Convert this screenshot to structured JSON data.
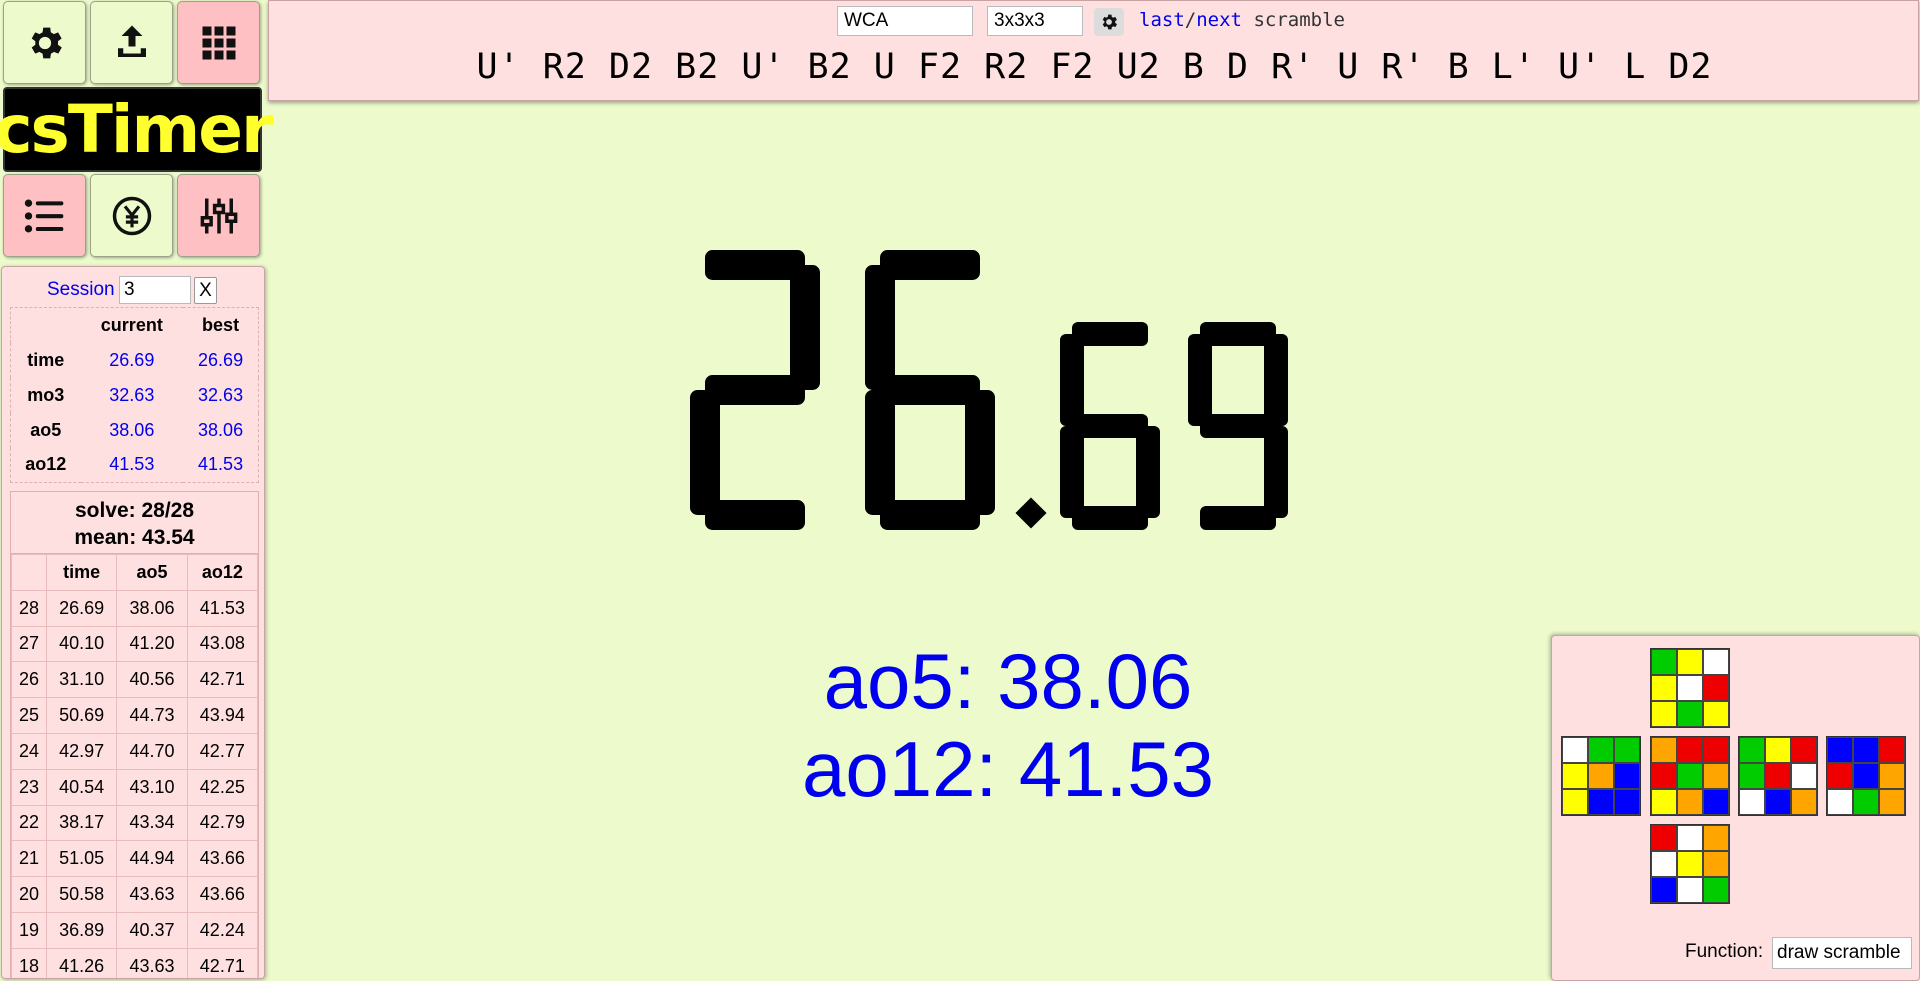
{
  "app": {
    "logo_text": "csTimer"
  },
  "toolbar": {
    "buttons": [
      "gear-icon",
      "export-icon",
      "grid-icon",
      "list-icon",
      "donate-icon",
      "sliders-icon"
    ]
  },
  "scramble": {
    "event_type": "WCA",
    "puzzle": "3x3x3",
    "last_label": "last",
    "sep": "/",
    "next_label": "next",
    "scramble_word": "scramble",
    "text": "U' R2 D2 B2 U' B2 U F2 R2 F2 U2 B D R' U R' B L' U' L D2"
  },
  "session": {
    "label": "Session",
    "value": "3",
    "delete_label": "X"
  },
  "stats": {
    "headers": [
      "current",
      "best"
    ],
    "rows": [
      {
        "name": "time",
        "current": "26.69",
        "best": "26.69"
      },
      {
        "name": "mo3",
        "current": "32.63",
        "best": "32.63"
      },
      {
        "name": "ao5",
        "current": "38.06",
        "best": "38.06"
      },
      {
        "name": "ao12",
        "current": "41.53",
        "best": "41.53"
      }
    ]
  },
  "summary": {
    "solve": "solve: 28/28",
    "mean": "mean: 43.54"
  },
  "times": {
    "headers": [
      "",
      "time",
      "ao5",
      "ao12"
    ],
    "rows": [
      [
        "28",
        "26.69",
        "38.06",
        "41.53"
      ],
      [
        "27",
        "40.10",
        "41.20",
        "43.08"
      ],
      [
        "26",
        "31.10",
        "40.56",
        "42.71"
      ],
      [
        "25",
        "50.69",
        "44.73",
        "43.94"
      ],
      [
        "24",
        "42.97",
        "44.70",
        "42.77"
      ],
      [
        "23",
        "40.54",
        "43.10",
        "42.25"
      ],
      [
        "22",
        "38.17",
        "43.34",
        "42.79"
      ],
      [
        "21",
        "51.05",
        "44.94",
        "43.66"
      ],
      [
        "20",
        "50.58",
        "43.63",
        "43.66"
      ],
      [
        "19",
        "36.89",
        "40.37",
        "42.24"
      ],
      [
        "18",
        "41.26",
        "43.63",
        "42.71"
      ]
    ]
  },
  "timer": {
    "display": "26.69"
  },
  "averages": {
    "ao5": "ao5: 38.06",
    "ao12": "ao12: 41.53"
  },
  "tool": {
    "function_label": "Function:",
    "function_value": "draw scramble",
    "colors": {
      "W": "#ffffff",
      "Y": "#ffff00",
      "G": "#00cc00",
      "B": "#0000ff",
      "R": "#ee0000",
      "O": "#ffa500"
    },
    "faces": {
      "U": [
        "G",
        "Y",
        "W",
        "Y",
        "W",
        "R",
        "Y",
        "G",
        "Y"
      ],
      "L": [
        "W",
        "G",
        "G",
        "Y",
        "O",
        "B",
        "Y",
        "B",
        "B"
      ],
      "F": [
        "O",
        "R",
        "R",
        "R",
        "G",
        "O",
        "Y",
        "O",
        "B"
      ],
      "R": [
        "G",
        "Y",
        "R",
        "G",
        "R",
        "W",
        "W",
        "B",
        "O"
      ],
      "B": [
        "B",
        "B",
        "R",
        "R",
        "B",
        "O",
        "W",
        "G",
        "O"
      ],
      "D": [
        "R",
        "W",
        "O",
        "W",
        "Y",
        "O",
        "B",
        "W",
        "G"
      ]
    }
  }
}
